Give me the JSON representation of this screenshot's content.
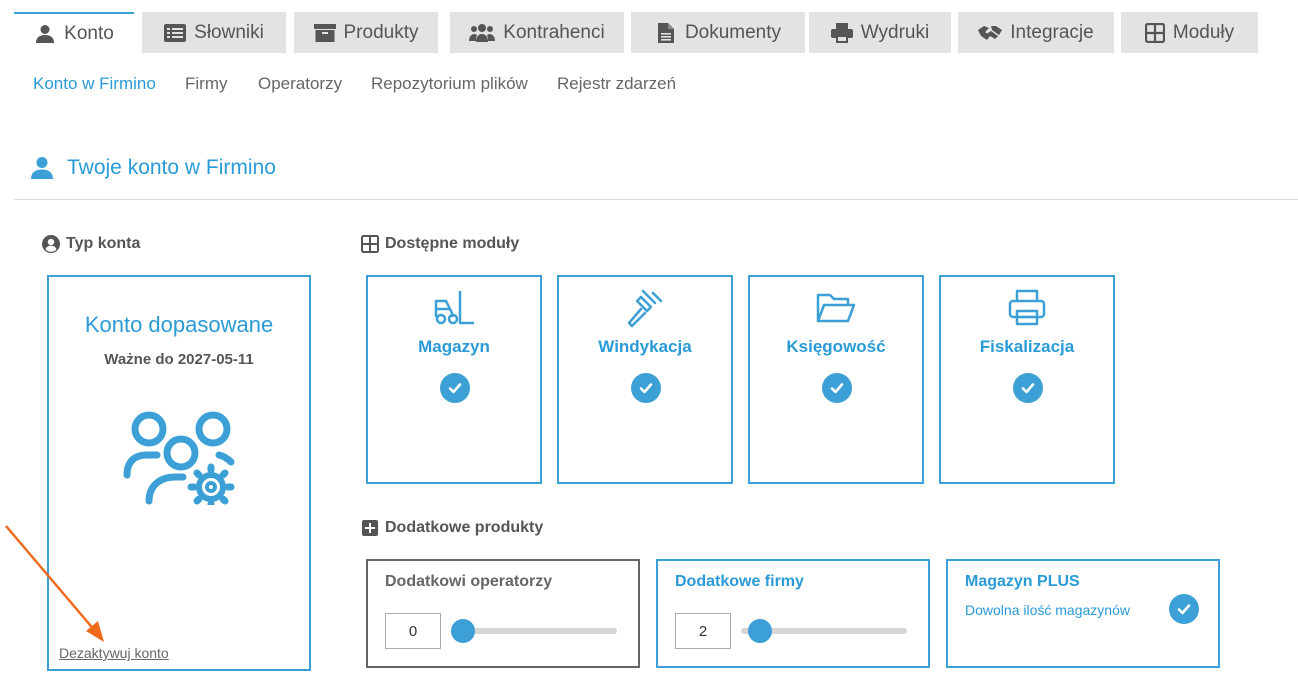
{
  "colors": {
    "accent": "#3ca0d6",
    "link_active": "#2a9bd7",
    "tab_bg": "#e3e3e3",
    "arrow": "#f06a1c"
  },
  "tabs": [
    {
      "label": "Konto",
      "icon": "user-icon",
      "active": true
    },
    {
      "label": "Słowniki",
      "icon": "list-icon",
      "active": false
    },
    {
      "label": "Produkty",
      "icon": "box-icon",
      "active": false
    },
    {
      "label": "Kontrahenci",
      "icon": "users-icon",
      "active": false
    },
    {
      "label": "Dokumenty",
      "icon": "document-icon",
      "active": false
    },
    {
      "label": "Wydruki",
      "icon": "printer-icon",
      "active": false
    },
    {
      "label": "Integracje",
      "icon": "handshake-icon",
      "active": false
    },
    {
      "label": "Moduły",
      "icon": "grid-icon",
      "active": false
    }
  ],
  "subnav": [
    {
      "label": "Konto w Firmino",
      "active": true
    },
    {
      "label": "Firmy",
      "active": false
    },
    {
      "label": "Operatorzy",
      "active": false
    },
    {
      "label": "Repozytorium plików",
      "active": false
    },
    {
      "label": "Rejestr zdarzeń",
      "active": false
    }
  ],
  "section": {
    "title": "Twoje konto w Firmino"
  },
  "account": {
    "heading": "Typ konta",
    "name": "Konto dopasowane",
    "valid_until": "Ważne do 2027-05-11",
    "deactivate": "Dezaktywuj konto"
  },
  "modules": {
    "heading": "Dostępne moduły",
    "items": [
      {
        "name": "Magazyn",
        "icon": "forklift-icon",
        "enabled": true
      },
      {
        "name": "Windykacja",
        "icon": "gavel-icon",
        "enabled": true
      },
      {
        "name": "Księgowość",
        "icon": "folder-icon",
        "enabled": true
      },
      {
        "name": "Fiskalizacja",
        "icon": "printer-icon",
        "enabled": true
      }
    ]
  },
  "products": {
    "heading": "Dodatkowe produkty",
    "operators": {
      "title": "Dodatkowi operatorzy",
      "value": "0",
      "fraction": 0
    },
    "companies": {
      "title": "Dodatkowe firmy",
      "value": "2",
      "fraction": 0.05
    },
    "warehouse_plus": {
      "title": "Magazyn PLUS",
      "subtitle": "Dowolna ilość magazynów",
      "enabled": true
    }
  }
}
